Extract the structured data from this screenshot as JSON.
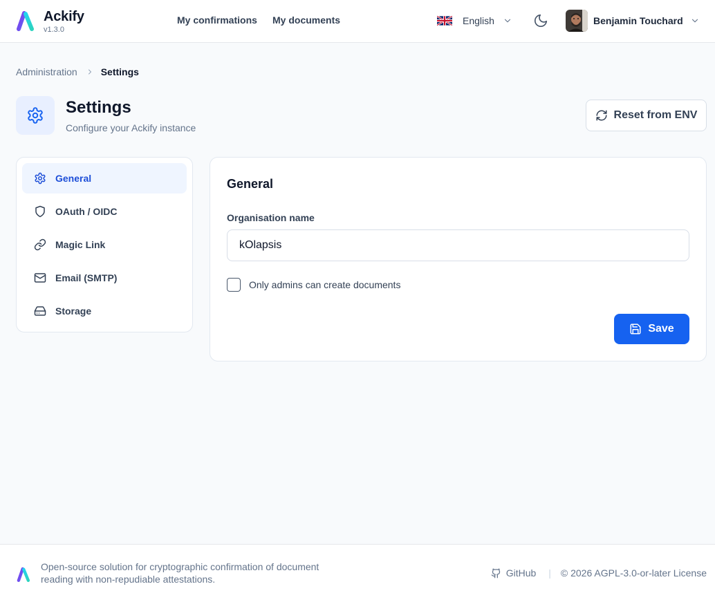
{
  "header": {
    "brand_name": "Ackify",
    "version": "v1.3.0",
    "nav": [
      {
        "label": "My confirmations"
      },
      {
        "label": "My documents"
      }
    ],
    "language": "English",
    "user_name": "Benjamin Touchard"
  },
  "breadcrumb": {
    "parent": "Administration",
    "current": "Settings"
  },
  "page": {
    "title": "Settings",
    "subtitle": "Configure your Ackify instance",
    "reset_label": "Reset from ENV"
  },
  "sidebar": {
    "items": [
      {
        "label": "General",
        "icon": "gear-icon",
        "active": true
      },
      {
        "label": "OAuth / OIDC",
        "icon": "shield-icon",
        "active": false
      },
      {
        "label": "Magic Link",
        "icon": "link-icon",
        "active": false
      },
      {
        "label": "Email (SMTP)",
        "icon": "mail-icon",
        "active": false
      },
      {
        "label": "Storage",
        "icon": "hard-drive-icon",
        "active": false
      }
    ]
  },
  "panel": {
    "title": "General",
    "org_label": "Organisation name",
    "org_value": "kOlapsis",
    "admins_only_label": "Only admins can create documents",
    "admins_only_checked": false,
    "save_label": "Save"
  },
  "footer": {
    "description": "Open-source solution for cryptographic confirmation of document reading with non-repudiable attestations.",
    "github_label": "GitHub",
    "separator": "|",
    "license": "© 2026 AGPL-3.0-or-later License"
  },
  "colors": {
    "primary": "#1662f0",
    "active_text": "#1d4ed8",
    "active_bg": "#eff5ff",
    "logo_gradient_start": "#7c3aed",
    "logo_gradient_end": "#22d3ee"
  }
}
